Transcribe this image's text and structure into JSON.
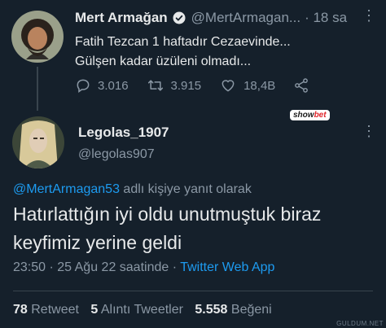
{
  "parent_tweet": {
    "name": "Mert Armağan",
    "handle": "@MertArmagan...",
    "time": "· 18 sa",
    "text_line1": "Fatih Tezcan 1 haftadır Cezaevinde...",
    "text_line2": "Gülşen kadar üzüleni olmadı...",
    "replies": "3.016",
    "retweets": "3.915",
    "likes": "18,4B"
  },
  "watermark": {
    "prefix": "show",
    "suffix": "bet"
  },
  "reply_tweet": {
    "name": "Legolas_1907",
    "handle": "@legolas907",
    "replying_to_handle": "@MertArmagan53",
    "replying_to_suffix": " adlı kişiye yanıt olarak",
    "text": "Hatırlattığın iyi oldu unutmuştuk biraz keyfimiz yerine geldi",
    "time": "23:50",
    "date": " · 25 Ağu 22 saatinde · ",
    "source": "Twitter Web App"
  },
  "stats": {
    "retweets_count": "78",
    "retweets_label": " Retweet",
    "quotes_count": "5",
    "quotes_label": " Alıntı Tweetler",
    "likes_count": "5.558",
    "likes_label": " Beğeni"
  },
  "credit": "GULDUM.NET",
  "icons": {
    "verified": "verified-badge-icon",
    "reply": "reply-icon",
    "retweet": "retweet-icon",
    "like": "heart-icon",
    "share": "share-icon",
    "more": "more-dots-icon"
  },
  "colors": {
    "background": "#15202b",
    "text": "#e7e9ea",
    "muted": "#8b98a5",
    "accent": "#1d9bf0",
    "divider": "#38444d"
  }
}
